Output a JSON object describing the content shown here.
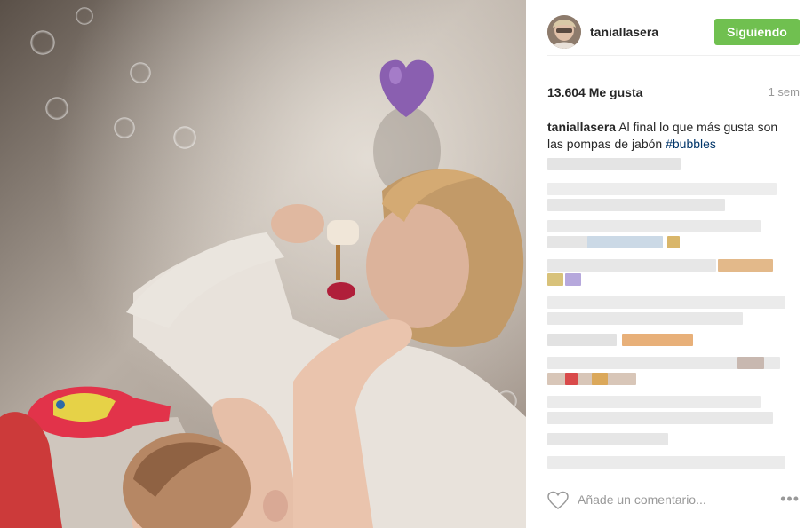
{
  "post": {
    "username": "taniallasera",
    "follow_label": "Siguiendo",
    "likes": "13.604 Me gusta",
    "time_ago": "1 sem",
    "caption": {
      "username": "taniallasera",
      "text": "Al final lo que más gusta son las pompas de jabón",
      "hashtag": "#bubbles"
    },
    "comment_placeholder": "Añade un comentario...",
    "more_label": "•••"
  },
  "colors": {
    "follow_button": "#70c050",
    "hashtag": "#003569",
    "muted": "#999999"
  },
  "icons": {
    "like": "heart-icon",
    "options": "more-options-icon"
  }
}
